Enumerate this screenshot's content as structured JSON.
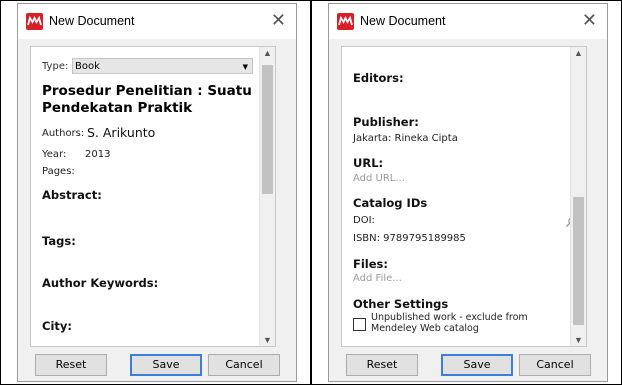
{
  "left": {
    "window_title": "New Document",
    "type_label": "Type:",
    "type_value": "Book",
    "title_text": "Prosedur Penelitian : Suatu Pendekatan Praktik",
    "authors_label": "Authors:",
    "authors_value": "S. Arikunto",
    "year_label": "Year:",
    "year_value": "2013",
    "pages_label": "Pages:",
    "abstract_label": "Abstract:",
    "tags_label": "Tags:",
    "author_keywords_label": "Author Keywords:",
    "city_label": "City:",
    "buttons": {
      "reset": "Reset",
      "save": "Save",
      "cancel": "Cancel"
    }
  },
  "right": {
    "window_title": "New Document",
    "editors_label": "Editors:",
    "publisher_label": "Publisher:",
    "publisher_value": "Jakarta: Rineka Cipta",
    "url_label": "URL:",
    "url_placeholder": "Add URL...",
    "catalog_label": "Catalog IDs",
    "doi_label": "DOI:",
    "isbn_text": "ISBN: 9789795189985",
    "files_label": "Files:",
    "files_placeholder": "Add File...",
    "other_settings_label": "Other Settings",
    "unpublished_text": "Unpublished work - exclude from Mendeley Web catalog",
    "buttons": {
      "reset": "Reset",
      "save": "Save",
      "cancel": "Cancel"
    }
  },
  "colors": {
    "brand": "#d71f27",
    "accent": "#3c7fd6"
  }
}
